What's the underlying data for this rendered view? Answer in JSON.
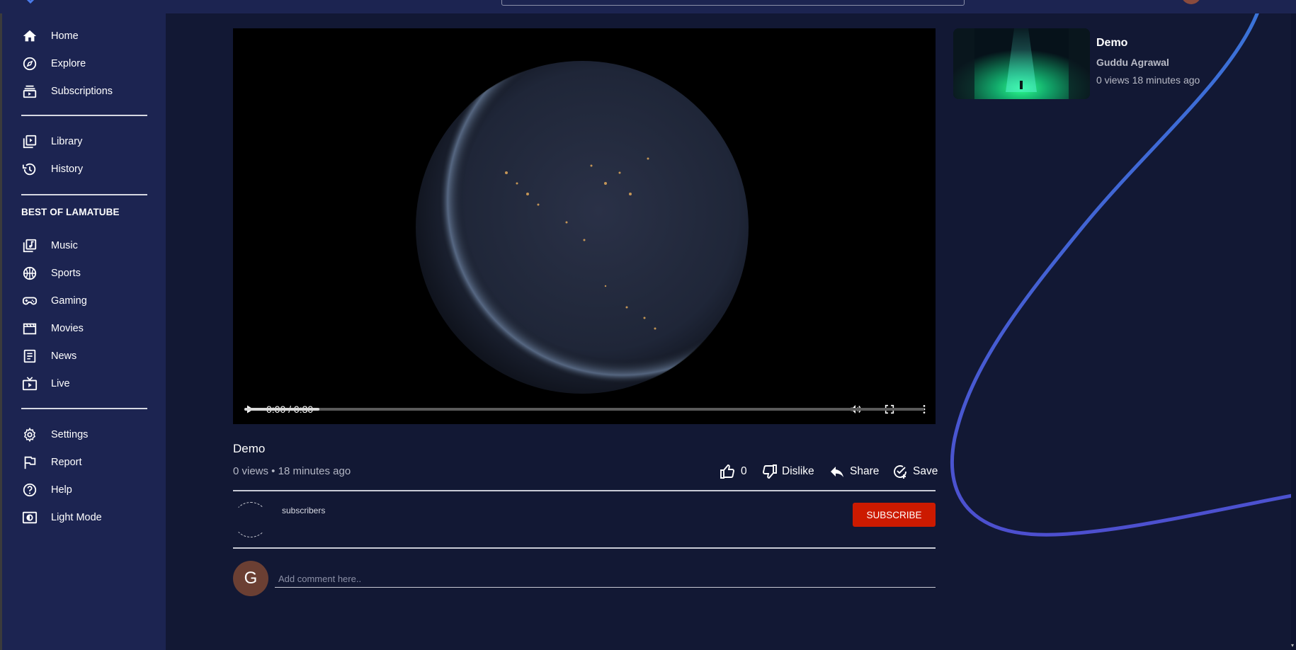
{
  "sidebar": {
    "items_top": [
      {
        "label": "Home",
        "icon": "home-icon"
      },
      {
        "label": "Explore",
        "icon": "compass-icon"
      },
      {
        "label": "Subscriptions",
        "icon": "subscriptions-icon"
      }
    ],
    "items_library": [
      {
        "label": "Library",
        "icon": "library-icon"
      },
      {
        "label": "History",
        "icon": "history-icon"
      }
    ],
    "section_title": "BEST OF LAMATUBE",
    "items_best": [
      {
        "label": "Music",
        "icon": "music-icon"
      },
      {
        "label": "Sports",
        "icon": "sports-icon"
      },
      {
        "label": "Gaming",
        "icon": "gaming-icon"
      },
      {
        "label": "Movies",
        "icon": "movies-icon"
      },
      {
        "label": "News",
        "icon": "news-icon"
      },
      {
        "label": "Live",
        "icon": "live-icon"
      }
    ],
    "items_bottom": [
      {
        "label": "Settings",
        "icon": "settings-icon"
      },
      {
        "label": "Report",
        "icon": "flag-icon"
      },
      {
        "label": "Help",
        "icon": "help-icon"
      },
      {
        "label": "Light Mode",
        "icon": "light-mode-icon"
      }
    ]
  },
  "player": {
    "time": "0:00 / 0:30",
    "progress_fraction": 0.11
  },
  "video": {
    "title": "Demo",
    "meta": "0 views • 18 minutes ago",
    "like_count": "0",
    "dislike_label": "Dislike",
    "share_label": "Share",
    "save_label": "Save"
  },
  "channel": {
    "subscribers_label": "subscribers",
    "subscribe_label": "SUBSCRIBE"
  },
  "comment": {
    "avatar_letter": "G",
    "placeholder": "Add comment here.."
  },
  "recommended": [
    {
      "title": "Demo",
      "channel": "Guddu Agrawal",
      "meta": "0 views 18 minutes ago"
    }
  ],
  "colors": {
    "background": "#121834",
    "sidebar": "#1c2451",
    "subscribe": "#cc1a00",
    "curve": "#3e5bd6"
  }
}
